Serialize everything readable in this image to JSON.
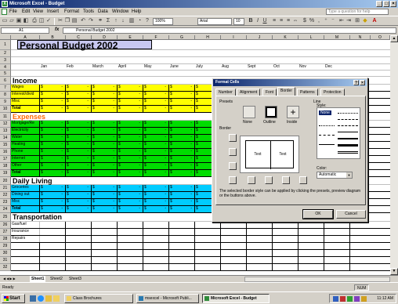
{
  "window": {
    "title": "Microsoft Excel - Budget",
    "app_icon": "excel-icon"
  },
  "menu": {
    "items": [
      "File",
      "Edit",
      "View",
      "Insert",
      "Format",
      "Tools",
      "Data",
      "Window",
      "Help"
    ],
    "help_placeholder": "Type a question for help"
  },
  "toolbar": {
    "font_name": "Arial",
    "font_size": "10",
    "zoom": "100%"
  },
  "formula_bar": {
    "cell_ref": "A1",
    "fx": "fx",
    "content": "Personal Budget 2002"
  },
  "columns": [
    "A",
    "B",
    "C",
    "D",
    "E",
    "F",
    "G",
    "H",
    "I",
    "J",
    "K",
    "L",
    "M",
    "N",
    "O"
  ],
  "rows": [
    "1",
    "2",
    "3",
    "4",
    "5",
    "6",
    "7",
    "8",
    "9",
    "10",
    "11",
    "12",
    "13",
    "14",
    "15",
    "16",
    "17",
    "18",
    "19",
    "20",
    "21",
    "22",
    "23",
    "24",
    "25",
    "26",
    "27",
    "28",
    "29",
    "30",
    "31",
    "32"
  ],
  "sheet": {
    "title": "Personal Budget 2002",
    "months": [
      "Jan",
      "Feb",
      "March",
      "April",
      "May",
      "June",
      "July",
      "Aug",
      "Sept",
      "Oct",
      "Nov",
      "Dec"
    ],
    "income": {
      "heading": "Income",
      "rows": [
        "Wages",
        "Interest/divid",
        "Misc",
        "Total"
      ],
      "currency": "$",
      "dash": "-"
    },
    "expenses": {
      "heading": "Expenses",
      "rows": [
        "Mortgage/Re",
        "Electricity",
        "Water",
        "Heating",
        "Phone",
        "Internet",
        "Other",
        "Total"
      ]
    },
    "daily": {
      "heading": "Daily Living",
      "rows": [
        "Groceries",
        "Dining out",
        "Misc",
        "Total"
      ]
    },
    "transport": {
      "heading": "Transportation",
      "rows": [
        "Gas/fuel",
        "Insurance",
        "Repairs"
      ]
    }
  },
  "tabs": [
    "Sheet1",
    "Sheet2",
    "Sheet3"
  ],
  "status": {
    "left": "Ready",
    "right": "NUM"
  },
  "dialog": {
    "title": "Format Cells",
    "tabs": [
      "Number",
      "Alignment",
      "Font",
      "Border",
      "Patterns",
      "Protection"
    ],
    "active_tab": "Border",
    "presets_label": "Presets",
    "preset_names": [
      "None",
      "Outline",
      "Inside"
    ],
    "border_label": "Border",
    "preview_text": "Text",
    "line_label": "Line",
    "style_label": "Style:",
    "style_none": "None",
    "color_label": "Color:",
    "color_value": "Automatic",
    "note": "The selected border style can be applied by clicking the presets, preview diagram or the buttons above.",
    "ok": "OK",
    "cancel": "Cancel"
  },
  "taskbar": {
    "start": "Start",
    "buttons": [
      "Class Brochures",
      "msexcel - Microsoft Publi...",
      "Microsoft Excel - Budget"
    ],
    "clock": "11:12 AM"
  },
  "colors": {
    "income_fill": "#ffff00",
    "expense_fill": "#00dd00",
    "daily_fill": "#00ccff",
    "title_fill": "#c8c8f0",
    "expenses_text": "#ff6600"
  }
}
